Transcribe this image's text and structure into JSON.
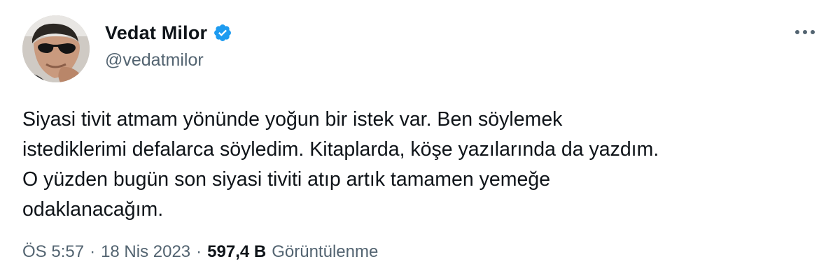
{
  "author": {
    "display_name": "Vedat Milor",
    "handle": "@vedatmilor",
    "verified": true,
    "avatar_icon": "profile-photo",
    "verified_icon": "verified-badge-icon"
  },
  "menu": {
    "more_icon": "more-options-icon"
  },
  "tweet": {
    "lines": [
      "Siyasi tivit atmam yönünde yoğun bir istek var.  Ben söylemek",
      "istediklerimi defalarca söyledim.  Kitaplarda, köşe yazılarında da yazdım.",
      "O yüzden bugün son siyasi tiviti atıp artık tamamen yemeğe",
      "odaklanacağım."
    ]
  },
  "meta": {
    "time": "ÖS 5:57",
    "separator": "·",
    "date": "18 Nis 2023",
    "views_count": "597,4 B",
    "views_label": "Görüntülenme"
  },
  "colors": {
    "text_primary": "#0f1419",
    "text_secondary": "#536471",
    "verified_blue": "#1d9bf0",
    "background": "#ffffff"
  }
}
